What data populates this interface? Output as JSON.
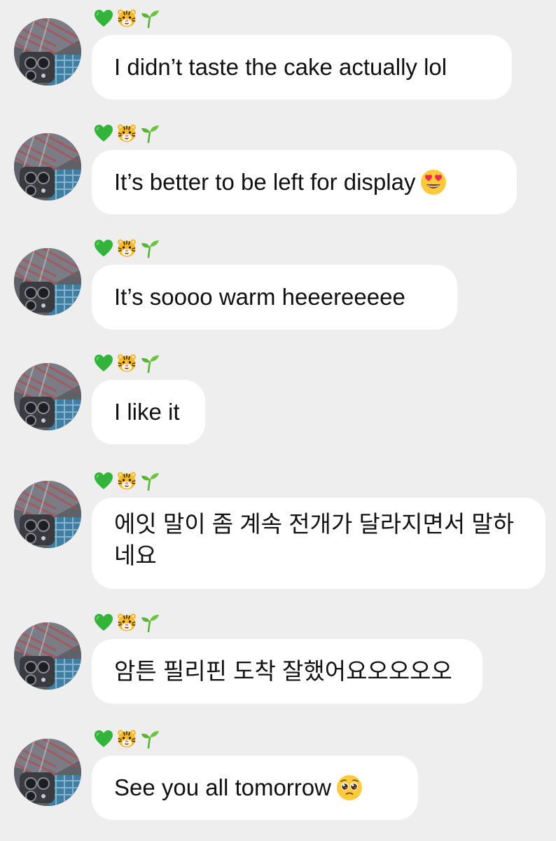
{
  "sender_badges": [
    "green-heart",
    "tiger-face",
    "seedling"
  ],
  "messages": [
    {
      "text": "I didn’t taste the cake actually lol",
      "trailing_emoji": ""
    },
    {
      "text": "It’s better to be left for display",
      "trailing_emoji": "heart-eyes"
    },
    {
      "text": "It’s soooo warm heeereeeee",
      "trailing_emoji": ""
    },
    {
      "text": "I like it",
      "trailing_emoji": ""
    },
    {
      "text": "에잇 말이 좀 계속 전개가 달라지면서 말하\n네요",
      "trailing_emoji": ""
    },
    {
      "text": "암튼 필리핀 도착 잘했어요오오오오",
      "trailing_emoji": ""
    },
    {
      "text": "See you all tomorrow",
      "trailing_emoji": "pleading-face"
    }
  ],
  "colors": {
    "background": "#eeeeef",
    "bubble": "#ffffff",
    "text": "#111111",
    "heart": "#33b33a",
    "tiger": "#f5b92a",
    "seedling": "#58b535"
  }
}
